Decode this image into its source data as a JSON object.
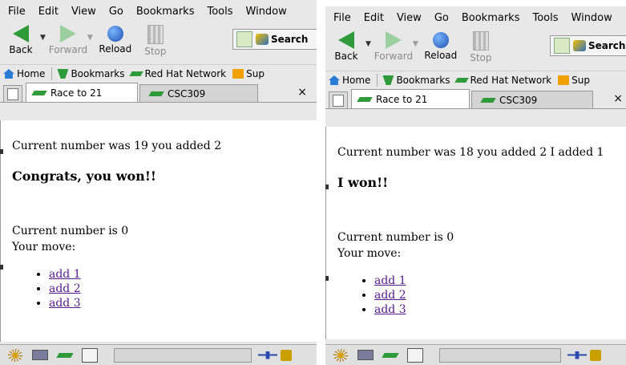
{
  "menu": [
    "File",
    "Edit",
    "View",
    "Go",
    "Bookmarks",
    "Tools",
    "Window"
  ],
  "nav": {
    "back": "Back",
    "forward": "Forward",
    "reload": "Reload",
    "stop": "Stop",
    "search": "Search"
  },
  "bookmarks": {
    "home": "Home",
    "bookmarks": "Bookmarks",
    "redhat": "Red Hat Network",
    "support": "Sup"
  },
  "tabs": {
    "active": "Race to 21",
    "inactive": "CSC309",
    "close": "×"
  },
  "left": {
    "message": "Current number was 19 you added 2",
    "result": "Congrats, you won!!",
    "status1": "Current number is 0",
    "status2": "Your move:",
    "moves": [
      "add 1",
      "add 2",
      "add 3"
    ]
  },
  "right": {
    "message": "Current number was 18 you added 2 I added 1",
    "result": "I won!!",
    "status1": "Current number is 0",
    "status2": "Your move:",
    "moves": [
      "add 1",
      "add 2",
      "add 3"
    ]
  }
}
